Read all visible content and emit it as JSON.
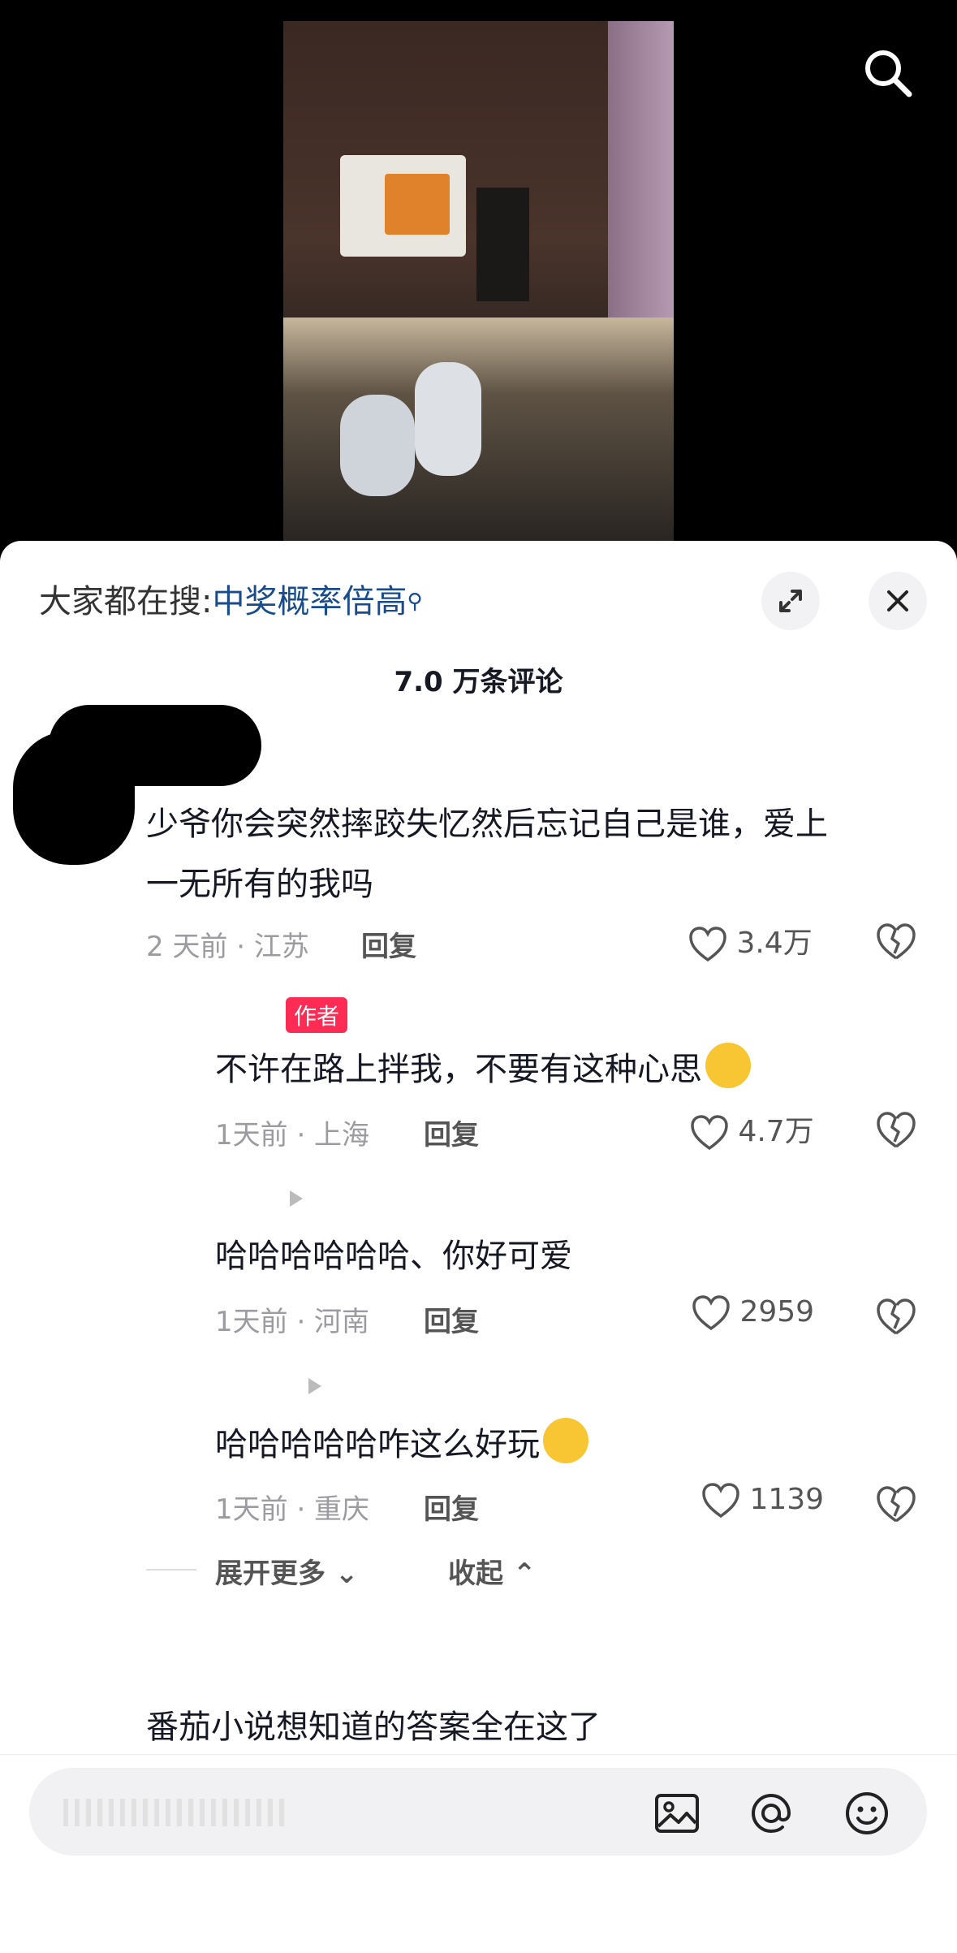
{
  "top_bar": {
    "search_icon": "search-icon"
  },
  "sheet": {
    "hot_search_label": "大家都在搜:",
    "hot_search_keyword": "中奖概率倍高",
    "expand_icon": "expand-icon",
    "close_icon": "close-icon",
    "comment_count": "7.0 万条评论"
  },
  "comments": [
    {
      "text_line1": "少爷你会突然摔跤失忆然后忘记自己是谁，爱上",
      "text_line2": "一无所有的我吗",
      "meta": "2 天前 · 江苏",
      "reply": "回复",
      "likes": "3.4万"
    }
  ],
  "replies": [
    {
      "badge": "作者",
      "text": "不许在路上拌我，不要有这种心思",
      "meta": "1天前 · 上海",
      "reply": "回复",
      "likes": "4.7万"
    },
    {
      "text": "哈哈哈哈哈哈、你好可爱",
      "meta": "1天前 · 河南",
      "reply": "回复",
      "likes": "2959"
    },
    {
      "text": "哈哈哈哈哈咋这么好玩",
      "meta": "1天前 · 重庆",
      "reply": "回复",
      "likes": "1139"
    }
  ],
  "thread_actions": {
    "expand_more": "展开更多",
    "collapse": "收起"
  },
  "next_comment": {
    "text": "番茄小说想知道的答案全在这了"
  },
  "input_bar": {
    "image_icon": "image-icon",
    "at_icon": "at-icon",
    "emoji_icon": "emoji-icon"
  }
}
